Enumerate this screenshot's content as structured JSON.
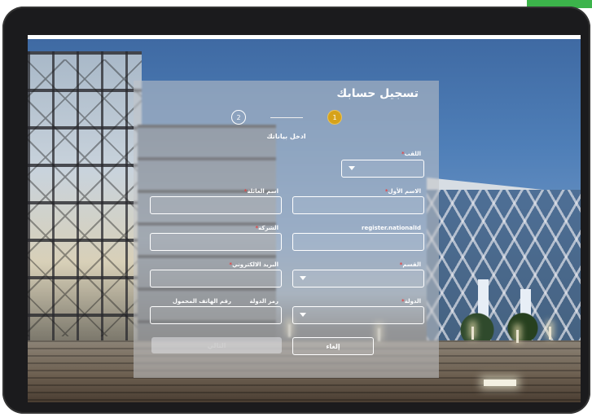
{
  "form": {
    "title": "تسجيل حسابك",
    "steps": [
      {
        "number": "1",
        "state": "active"
      },
      {
        "number": "2",
        "state": "inactive"
      }
    ],
    "subtitle": "ادخل بياناتك",
    "fields": {
      "title_select": {
        "label": "اللقب",
        "required": true,
        "type": "select",
        "value": ""
      },
      "first_name": {
        "label": "الاسم الأول",
        "required": true,
        "type": "text",
        "value": ""
      },
      "family_name": {
        "label": "اسم العائلة",
        "required": true,
        "type": "text",
        "value": ""
      },
      "national_id": {
        "label": "register.nationalId",
        "required": true,
        "type": "text",
        "value": ""
      },
      "company": {
        "label": "الشركة",
        "required": true,
        "type": "text",
        "value": ""
      },
      "department": {
        "label": "القسم",
        "required": true,
        "type": "select",
        "value": ""
      },
      "email": {
        "label": "البريد الالكتروني",
        "required": true,
        "type": "text",
        "value": ""
      },
      "country": {
        "label": "الدولة",
        "required": true,
        "type": "select",
        "value": ""
      },
      "country_code": {
        "label": "رمز الدولة",
        "required": false,
        "type": "text",
        "value": ""
      },
      "mobile": {
        "label": "رقم الهاتف المحمول",
        "required": false,
        "type": "text",
        "value": ""
      }
    },
    "buttons": {
      "cancel": "إلغاء",
      "next": "التالي"
    },
    "required_marker": "*"
  },
  "colors": {
    "accent": "#d6a21a",
    "required": "#e34545",
    "card": "rgba(195,196,200,0.55)",
    "corner_tab": "#3cb44b"
  },
  "icons": {
    "select_arrow": "caret-down-icon"
  }
}
